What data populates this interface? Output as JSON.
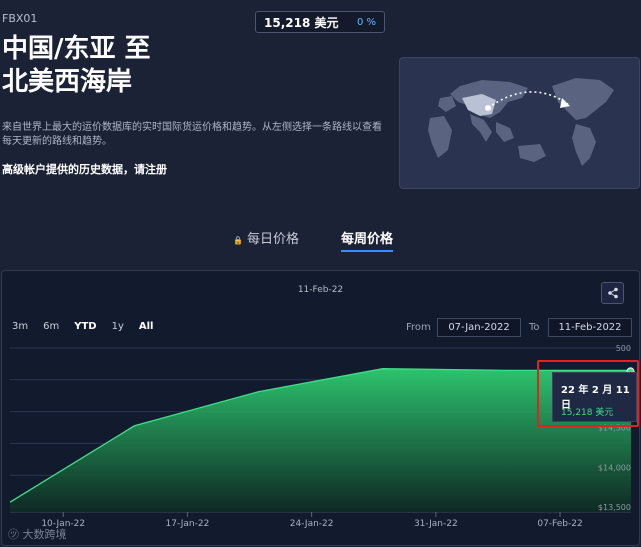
{
  "route_code": "FBX01",
  "price_badge": {
    "price": "15,218 美元",
    "change": "0 %"
  },
  "title": {
    "line1": "中国/东亚 至",
    "line2": "北美西海岸"
  },
  "description": "来自世界上最大的运价数据库的实时国际货运价格和趋势。从左侧选择一条路线以查看每天更新的路线和趋势。",
  "premium_notice": "高级帐户提供的历史数据，请注册",
  "tabs": {
    "daily": "每日价格",
    "weekly": "每周价格"
  },
  "chart_header_date": "11-Feb-22",
  "range_buttons": [
    "3m",
    "6m",
    "YTD",
    "1y",
    "All"
  ],
  "from_label": "From",
  "to_label": "To",
  "from_value": "07-Jan-2022",
  "to_value": "11-Feb-2022",
  "tooltip": {
    "date": "22 年 2 月 11 日",
    "price": "15,218 美元"
  },
  "watermark": "大数跨境",
  "colors": {
    "accent": "#3b8cff",
    "series": "#2ecc71",
    "highlight": "#e0241b"
  },
  "chart_data": {
    "type": "area",
    "x": [
      "2022-01-07",
      "2022-01-14",
      "2022-01-21",
      "2022-01-28",
      "2022-02-04",
      "2022-02-11"
    ],
    "x_tick_labels": [
      "10-Jan-22",
      "17-Jan-22",
      "24-Jan-22",
      "31-Jan-22",
      "07-Feb-22"
    ],
    "x_tick_dates": [
      "2022-01-10",
      "2022-01-17",
      "2022-01-24",
      "2022-01-31",
      "2022-02-07"
    ],
    "x_range": [
      "2022-01-07",
      "2022-02-11"
    ],
    "series": [
      {
        "values": [
          13560,
          14520,
          14950,
          15240,
          15218,
          15218
        ]
      }
    ],
    "y_tick_labels": [
      "$13,500",
      "$14,000",
      "$14,500",
      "500",
      "300"
    ],
    "y_tick_values": [
      13500,
      14000,
      14500,
      15500,
      15000
    ],
    "ylim": [
      13500,
      15500
    ],
    "grid": true
  }
}
